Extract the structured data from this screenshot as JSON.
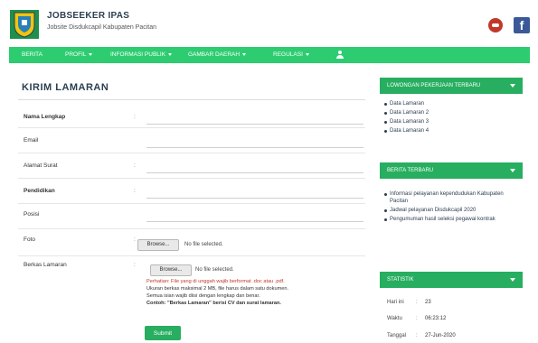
{
  "header": {
    "site_title": "JOBSEEKER IPAS",
    "site_subtitle": "Jobsite Disdukcapil Kabupaten Pacitan"
  },
  "nav": {
    "items": [
      "BERITA",
      "PROFIL",
      "INFORMASI PUBLIK",
      "GAMBAR DAERAH",
      "REGULASI"
    ]
  },
  "form": {
    "title": "KIRIM LAMARAN",
    "colon": ":",
    "fields": [
      {
        "label": "Nama Lengkap"
      },
      {
        "label": "Email"
      },
      {
        "label": "Alamat Surat"
      },
      {
        "label": "Pendidikan"
      },
      {
        "label": "Posisi"
      },
      {
        "label": "Foto"
      },
      {
        "label": "Berkas Lamaran"
      }
    ],
    "file_button": "Browse...",
    "file_status": "No file selected.",
    "note_red": "Perhatian: File yang di unggah wajib berformat .doc atau .pdf.",
    "note_lines": [
      "Ukuran berkas maksimal 2 MB, file harus dalam satu dokumen.",
      "Semua isian wajib diisi dengan lengkap dan benar.",
      "Contoh: \"Berkas Lamaran\" berisi CV dan surat lamaran."
    ],
    "submit_label": "Submit"
  },
  "sidebar": {
    "widgets": [
      {
        "title": "LOWONGAN PEKERJAAN TERBARU",
        "items": [
          "Data Lamaran",
          "Data Lamaran 2",
          "Data Lamaran 3",
          "Data Lamaran 4"
        ]
      },
      {
        "title": "BERITA TERBARU",
        "items": [
          "Informasi pelayanan kependudukan Kabupaten Pacitan",
          "Jadwal pelayanan Disdukcapil 2020",
          "Pengumuman hasil seleksi pegawai kontrak"
        ]
      },
      {
        "title": "STATISTIK",
        "stats": [
          {
            "label": "Hari ini",
            "value": "23"
          },
          {
            "label": "Waktu",
            "value": "06:23:12"
          },
          {
            "label": "Tanggal",
            "value": "27-Jun-2020"
          }
        ]
      }
    ]
  }
}
